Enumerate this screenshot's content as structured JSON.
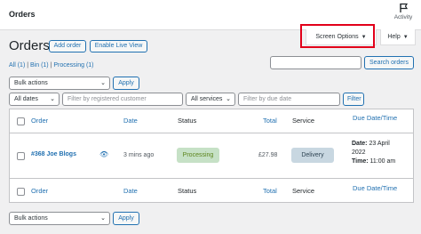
{
  "header": {
    "title": "Orders",
    "activity_label": "Activity"
  },
  "tabs": {
    "screen_options": "Screen Options",
    "help": "Help"
  },
  "page": {
    "heading": "Orders",
    "add_order": "Add order",
    "live_view": "Enable Live View"
  },
  "subsubsub": {
    "all": "All (1)",
    "bin": "Bin (1)",
    "processing": "Processing (1)",
    "sep": "|"
  },
  "search": {
    "placeholder": "",
    "button": "Search orders"
  },
  "top_actions": {
    "bulk": "Bulk actions",
    "apply": "Apply"
  },
  "filters": {
    "dates": "All dates",
    "customer_placeholder": "Filter by registered customer",
    "services": "All services",
    "due_placeholder": "Filter by due date",
    "filter_btn": "Filter"
  },
  "columns": {
    "order": "Order",
    "date": "Date",
    "status": "Status",
    "total": "Total",
    "service": "Service",
    "due": "Due Date/Time"
  },
  "rows": [
    {
      "order": "#368 Joe Blogs",
      "date": "3 mins ago",
      "status": "Processing",
      "total": "£27.98",
      "service": "Delivery",
      "due_date_label": "Date:",
      "due_date_value": "23 April",
      "due_year": "2022",
      "due_time_label": "Time:",
      "due_time_value": "11:00 am"
    }
  ],
  "bottom_actions": {
    "bulk": "Bulk actions",
    "apply": "Apply"
  },
  "colors": {
    "accent": "#2271b1",
    "highlight": "#e2001a",
    "processing_bg": "#c6e1c6",
    "processing_text": "#5b841b",
    "service_bg": "#c8d7e1"
  }
}
